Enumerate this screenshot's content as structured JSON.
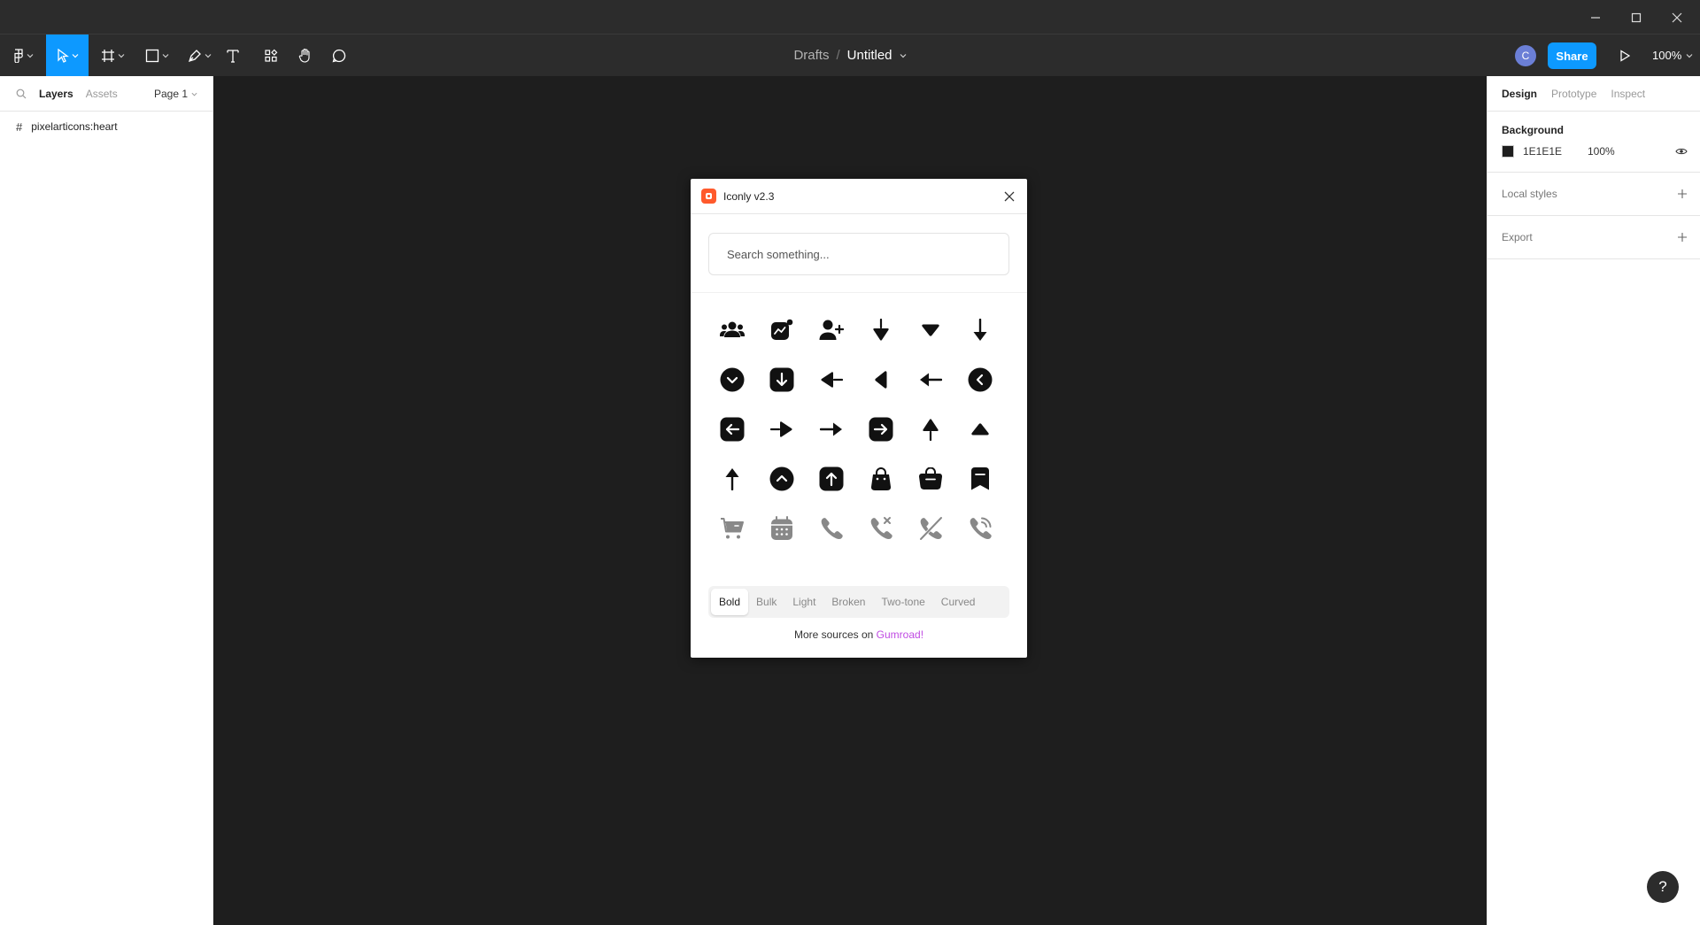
{
  "toolbar": {
    "breadcrumb_parent": "Drafts",
    "breadcrumb_separator": "/",
    "file_name": "Untitled",
    "avatar_initial": "C",
    "share_label": "Share",
    "zoom": "100%"
  },
  "left_panel": {
    "tabs": [
      "Layers",
      "Assets"
    ],
    "page_selector": "Page 1",
    "layers": [
      {
        "name": "pixelarticons:heart"
      }
    ]
  },
  "right_panel": {
    "tabs": [
      "Design",
      "Prototype",
      "Inspect"
    ],
    "background_title": "Background",
    "background_hex": "1E1E1E",
    "background_opacity": "100%",
    "local_styles": "Local styles",
    "export": "Export"
  },
  "plugin": {
    "title": "Iconly v2.3",
    "search_placeholder": "Search something...",
    "icons": [
      "users-icon",
      "activity-icon",
      "add-user-icon",
      "arrow-down-2-icon",
      "arrow-down-3-icon",
      "arrow-down-icon",
      "arrow-down-circle-icon",
      "arrow-down-square-icon",
      "arrow-left-2-icon",
      "arrow-left-3-icon",
      "arrow-left-icon",
      "arrow-left-circle-icon",
      "arrow-left-square-icon",
      "arrow-right-2-icon",
      "arrow-right-icon",
      "arrow-right-square-icon",
      "arrow-up-2-icon",
      "arrow-up-3-icon",
      "arrow-up-icon",
      "arrow-up-circle-icon",
      "arrow-up-square-icon",
      "bag-icon",
      "bag-2-icon",
      "bookmark-icon",
      "buy-icon",
      "calendar-icon",
      "call-icon",
      "call-missed-icon",
      "call-silent-icon",
      "calling-icon"
    ],
    "style_tabs": [
      "Bold",
      "Bulk",
      "Light",
      "Broken",
      "Two-tone",
      "Curved"
    ],
    "active_style": "Bold",
    "footer_text": "More sources on ",
    "footer_link": "Gumroad!"
  },
  "help_label": "?",
  "colors": {
    "accent": "#0d99ff",
    "canvas": "#1e1e1e",
    "chrome": "#2c2c2c",
    "plugin_brand": "#ff5a2c",
    "link": "#c04be3"
  }
}
